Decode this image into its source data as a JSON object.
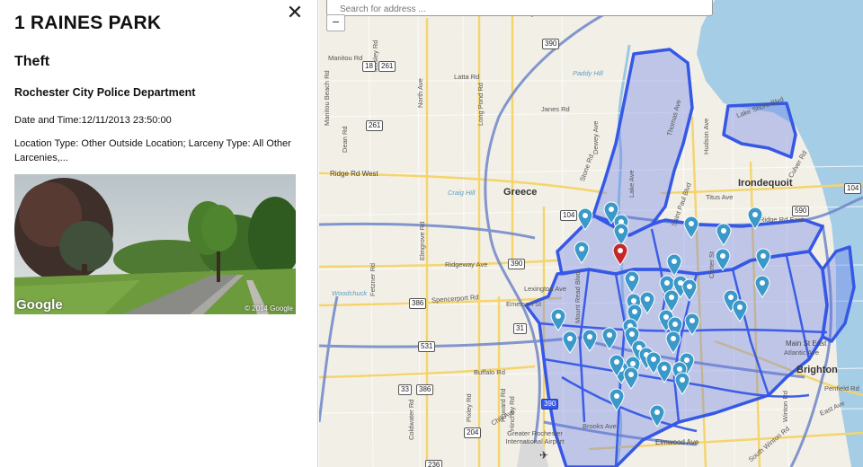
{
  "detail": {
    "title": "1 RAINES PARK",
    "close_glyph": "✕",
    "category": "Theft",
    "agency": "Rochester City Police Department",
    "datetime": "Date and Time:12/11/2013 23:50:00",
    "description": "Location Type: Other Outside Location; Larceny Type: All Other Larcenies,...",
    "photo": {
      "brand": "Google",
      "copyright": "© 2014 Google"
    }
  },
  "map": {
    "search_placeholder": "Search for address ...",
    "zoom_out": "−",
    "colors": {
      "crime_marker": "#3a99c8",
      "selected_marker": "#c62828",
      "district": "#3558e6"
    },
    "places": [
      "Greece",
      "Irondequoit",
      "Brighton"
    ],
    "roads": [
      "Ontario State Pkwy",
      "Manitou Rd",
      "Latta Rd",
      "Long Pond Rd",
      "Janes Rd",
      "Ridge Rd West",
      "Ridgeway Ave",
      "Spencerport Rd",
      "Lexington Ave",
      "Emerson St",
      "Buffalo Rd",
      "Chili Ave",
      "Brooks Ave",
      "Elmwood Ave",
      "Main St East",
      "Atlantic Ave",
      "Titus Ave",
      "Ridge Rd East",
      "Culver Rd",
      "Lake Shore Blvd",
      "Dewey Ave",
      "Stone Rd",
      "Lake Ave",
      "Thomas Ave",
      "Hudson Ave",
      "Saint Paul Blvd",
      "Carter St",
      "Mount Read Blvd",
      "Winton Rd",
      "East Ave",
      "Penfield Rd",
      "South Winton Rd",
      "Mosley Rd",
      "Fetzner Rd",
      "Elmgrove Rd",
      "Dean Rd",
      "Hinchey Rd",
      "Pixley Rd",
      "Howard Rd",
      "Coldwater Rd",
      "Manitou Beach Rd",
      "North Ave",
      "Paddy Hill",
      "Craig Hill",
      "Woodchuck",
      "Greater Rochester International Airport"
    ],
    "route_shields": [
      "390",
      "18",
      "261",
      "104",
      "261",
      "390",
      "386",
      "31",
      "531",
      "33",
      "386",
      "204",
      "390",
      "590",
      "104",
      "236"
    ],
    "crime_marker_count": 45,
    "selected_marker_count": 1
  }
}
